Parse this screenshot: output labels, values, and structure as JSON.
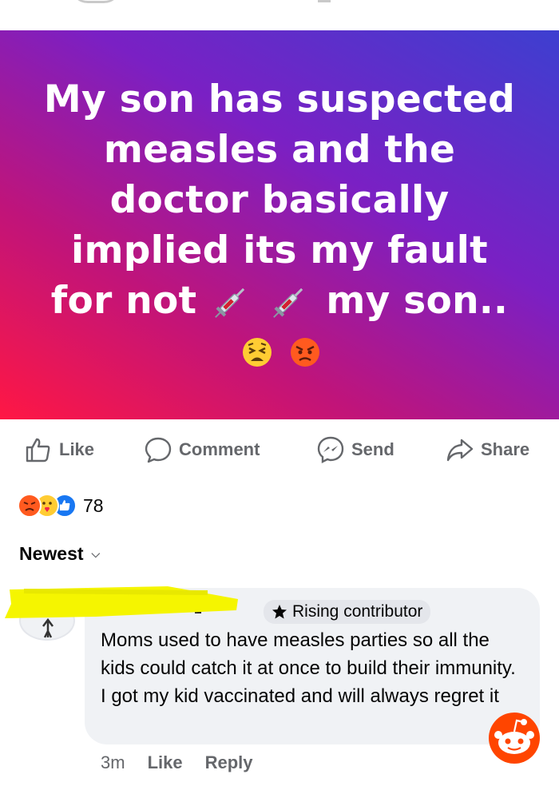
{
  "post": {
    "text": "My son has suspected measles and the doctor basically implied its my fault for not",
    "text_after": "my son..",
    "icons": [
      "syringe-emoji",
      "syringe-emoji",
      "tired-face-emoji",
      "angry-face-emoji"
    ]
  },
  "actions": {
    "like": "Like",
    "comment": "Comment",
    "send": "Send",
    "share": "Share"
  },
  "reactions": {
    "types": [
      "angry",
      "care",
      "like"
    ],
    "count": "78"
  },
  "sort": {
    "label": "Newest"
  },
  "comment": {
    "badge": "Rising contributor",
    "text": "Moms used to have measles parties so all the kids could catch it at once to build their immunity.  I got my kid vaccinated and will always regret it",
    "time": "3m",
    "like": "Like",
    "reply": "Reply"
  },
  "colors": {
    "banner_start": "#3d3fd0",
    "banner_end": "#ff1744",
    "highlight": "#f5f500",
    "fb_blue": "#1877f2",
    "reddit_orange": "#ff4500"
  }
}
